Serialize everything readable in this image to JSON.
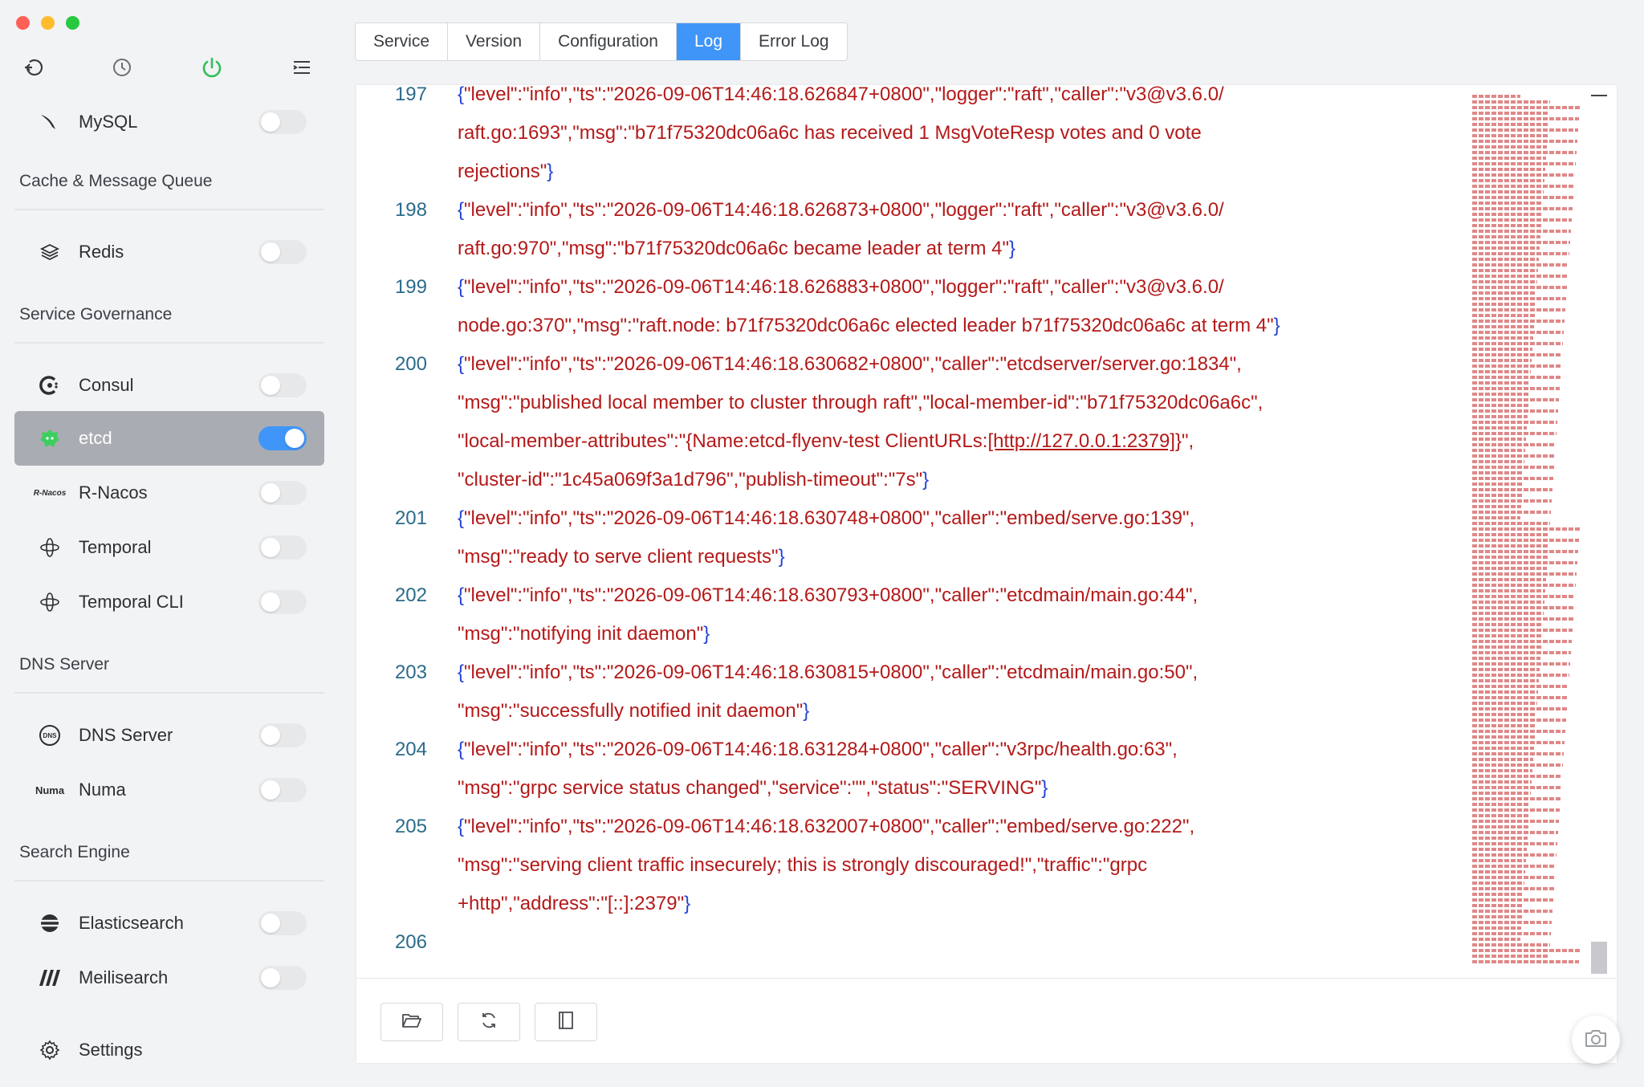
{
  "sidebar": {
    "items_top": [
      {
        "label": "MySQL",
        "enabled": false
      }
    ],
    "groups": [
      {
        "title": "Cache & Message Queue"
      },
      {
        "title": "Service Governance"
      },
      {
        "title": "DNS Server"
      },
      {
        "title": "Search Engine"
      }
    ],
    "redis": {
      "label": "Redis",
      "enabled": false
    },
    "consul": {
      "label": "Consul",
      "enabled": false
    },
    "etcd": {
      "label": "etcd",
      "enabled": true
    },
    "rnacos": {
      "label": "R-Nacos",
      "icon_text": "R-Nacos",
      "enabled": false
    },
    "temporal": {
      "label": "Temporal",
      "enabled": false
    },
    "temporal_cli": {
      "label": "Temporal CLI",
      "enabled": false
    },
    "dns_server": {
      "label": "DNS Server",
      "icon_text": "DNS",
      "enabled": false
    },
    "numa": {
      "label": "Numa",
      "icon_text": "Numa",
      "enabled": false
    },
    "elasticsearch": {
      "label": "Elasticsearch",
      "enabled": false
    },
    "meilisearch": {
      "label": "Meilisearch",
      "enabled": false
    },
    "settings": {
      "label": "Settings"
    }
  },
  "tabs": [
    "Service",
    "Version",
    "Configuration",
    "Log",
    "Error Log"
  ],
  "active_tab": "Log",
  "colors": {
    "accent": "#3f95f8",
    "log_text": "#b41919",
    "line_number": "#2b6b8a",
    "brace": "#2543d6",
    "active_item_bg": "#a9acb2"
  },
  "log": [
    {
      "n": "197",
      "text": "{\"level\":\"info\",\"ts\":\"2026-09-06T14:46:18.626847+0800\",\"logger\":\"raft\",\"caller\":\"v3@v3.6.0/"
    },
    {
      "n": "",
      "text": "raft.go:1693\",\"msg\":\"b71f75320dc06a6c has received 1 MsgVoteResp votes and 0 vote"
    },
    {
      "n": "",
      "text": "rejections\"}"
    },
    {
      "n": "198",
      "text": "{\"level\":\"info\",\"ts\":\"2026-09-06T14:46:18.626873+0800\",\"logger\":\"raft\",\"caller\":\"v3@v3.6.0/"
    },
    {
      "n": "",
      "text": "raft.go:970\",\"msg\":\"b71f75320dc06a6c became leader at term 4\"}"
    },
    {
      "n": "199",
      "text": "{\"level\":\"info\",\"ts\":\"2026-09-06T14:46:18.626883+0800\",\"logger\":\"raft\",\"caller\":\"v3@v3.6.0/"
    },
    {
      "n": "",
      "text": "node.go:370\",\"msg\":\"raft.node: b71f75320dc06a6c elected leader b71f75320dc06a6c at term 4\"}"
    },
    {
      "n": "200",
      "text": "{\"level\":\"info\",\"ts\":\"2026-09-06T14:46:18.630682+0800\",\"caller\":\"etcdserver/server.go:1834\","
    },
    {
      "n": "",
      "text": "\"msg\":\"published local member to cluster through raft\",\"local-member-id\":\"b71f75320dc06a6c\","
    },
    {
      "n": "",
      "text": "\"local-member-attributes\":\"{Name:etcd-flyenv-test ClientURLs:[http://127.0.0.1:2379]}\","
    },
    {
      "n": "",
      "text": "\"cluster-id\":\"1c45a069f3a1d796\",\"publish-timeout\":\"7s\"}"
    },
    {
      "n": "201",
      "text": "{\"level\":\"info\",\"ts\":\"2026-09-06T14:46:18.630748+0800\",\"caller\":\"embed/serve.go:139\","
    },
    {
      "n": "",
      "text": "\"msg\":\"ready to serve client requests\"}"
    },
    {
      "n": "202",
      "text": "{\"level\":\"info\",\"ts\":\"2026-09-06T14:46:18.630793+0800\",\"caller\":\"etcdmain/main.go:44\","
    },
    {
      "n": "",
      "text": "\"msg\":\"notifying init daemon\"}"
    },
    {
      "n": "203",
      "text": "{\"level\":\"info\",\"ts\":\"2026-09-06T14:46:18.630815+0800\",\"caller\":\"etcdmain/main.go:50\","
    },
    {
      "n": "",
      "text": "\"msg\":\"successfully notified init daemon\"}"
    },
    {
      "n": "204",
      "text": "{\"level\":\"info\",\"ts\":\"2026-09-06T14:46:18.631284+0800\",\"caller\":\"v3rpc/health.go:63\","
    },
    {
      "n": "",
      "text": "\"msg\":\"grpc service status changed\",\"service\":\"\",\"status\":\"SERVING\"}"
    },
    {
      "n": "205",
      "text": "{\"level\":\"info\",\"ts\":\"2026-09-06T14:46:18.632007+0800\",\"caller\":\"embed/serve.go:222\","
    },
    {
      "n": "",
      "text": "\"msg\":\"serving client traffic insecurely; this is strongly discouraged!\",\"traffic\":\"grpc"
    },
    {
      "n": "",
      "text": "+http\",\"address\":\"[::]:2379\"}"
    },
    {
      "n": "206",
      "text": ""
    }
  ],
  "bottom_toolbar": {
    "icons": [
      "folder-open-icon",
      "refresh-icon",
      "sidebar-panel-icon"
    ]
  },
  "toolbar_icons": [
    "back-icon",
    "history-icon",
    "power-icon",
    "menu-icon"
  ],
  "camera_icon": "camera-icon"
}
